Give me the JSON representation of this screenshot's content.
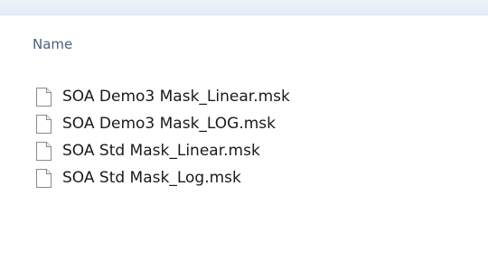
{
  "column": {
    "name_label": "Name"
  },
  "files": [
    {
      "name": "SOA Demo3 Mask_Linear.msk",
      "icon": "file-icon"
    },
    {
      "name": "SOA Demo3 Mask_LOG.msk",
      "icon": "file-icon"
    },
    {
      "name": "SOA Std Mask_Linear.msk",
      "icon": "file-icon"
    },
    {
      "name": "SOA Std Mask_Log.msk",
      "icon": "file-icon"
    }
  ],
  "colors": {
    "header_text": "#4c607a",
    "file_text": "#1a1a1a",
    "topbar": "#e4ecf7"
  }
}
